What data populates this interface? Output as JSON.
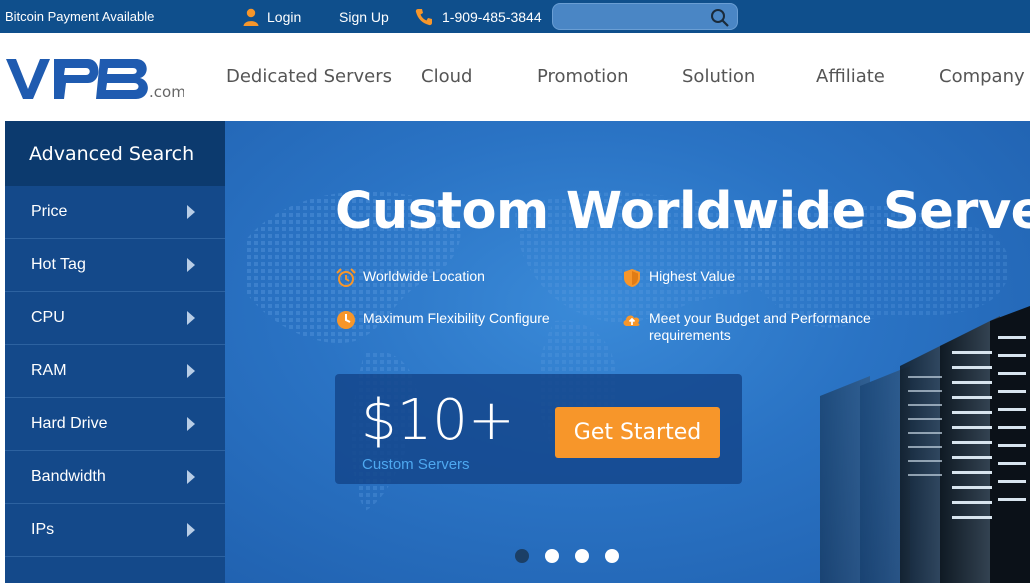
{
  "topbar": {
    "promo": "Bitcoin Payment Available",
    "login": "Login",
    "signup": "Sign Up",
    "phone": "1-909-485-3844",
    "search_placeholder": ""
  },
  "header": {
    "logo_text": "VPB",
    "logo_suffix": ".com",
    "nav": [
      "Dedicated Servers",
      "Cloud",
      "Promotion",
      "Solution",
      "Affiliate",
      "Company"
    ]
  },
  "sidebar": {
    "title": "Advanced Search",
    "items": [
      "Price",
      "Hot Tag",
      "CPU",
      "RAM",
      "Hard Drive",
      "Bandwidth",
      "IPs"
    ]
  },
  "hero": {
    "title": "Custom Worldwide Servers",
    "features": [
      "Worldwide Location",
      "Highest Value",
      "Maximum Flexibility Configure",
      "Meet your Budget and Performance requirements"
    ],
    "price": "$10+",
    "price_sub": "Custom Servers",
    "cta": "Get Started",
    "slides": 4,
    "active_slide": 1
  },
  "colors": {
    "topbar": "#0f4f8c",
    "sidebar": "#14498a",
    "hero": "#2a73c4",
    "cta": "#f7962a",
    "accent_icon": "#f7962a"
  }
}
